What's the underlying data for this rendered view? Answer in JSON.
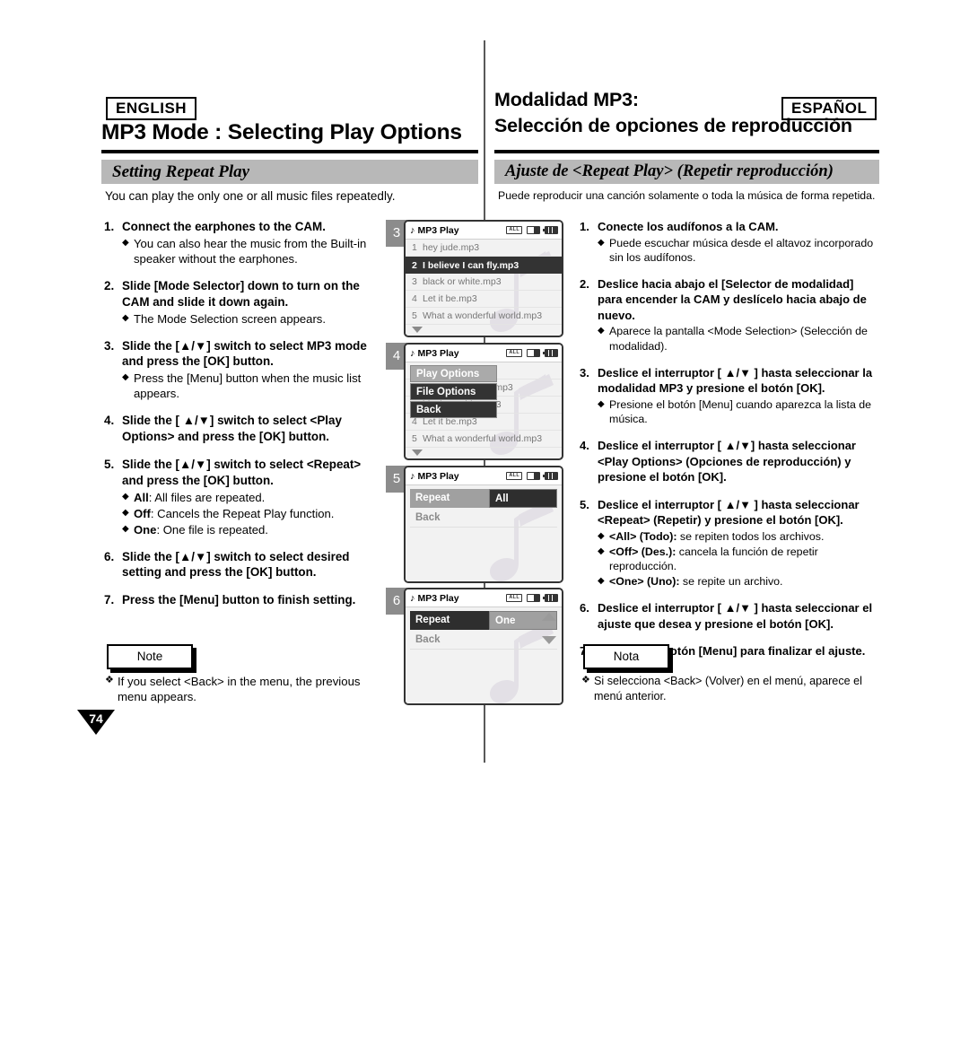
{
  "page": {
    "number": "74"
  },
  "english": {
    "lang_tag": "ENGLISH",
    "title": "MP3 Mode : Selecting Play Options",
    "banner": "Setting Repeat Play",
    "intro": "You can play the only one or all music files repeatedly.",
    "steps": [
      {
        "num": "1.",
        "main": "Connect the earphones to the CAM.",
        "subs": [
          {
            "mark": "◆",
            "text": "You can also hear the music from the Built-in speaker without the earphones."
          }
        ]
      },
      {
        "num": "2.",
        "main": "Slide [Mode Selector] down to turn on the CAM and slide it down again.",
        "subs": [
          {
            "mark": "◆",
            "text": "The Mode Selection screen appears."
          }
        ]
      },
      {
        "num": "3.",
        "main": "Slide the [▲/▼] switch to select MP3 mode and press the [OK] button.",
        "subs": [
          {
            "mark": "◆",
            "text": "Press the [Menu] button when the music list appears."
          }
        ]
      },
      {
        "num": "4.",
        "main": "Slide the [ ▲/▼] switch to select <Play Options> and press the [OK] button.",
        "subs": []
      },
      {
        "num": "5.",
        "main": "Slide the [▲/▼] switch to select <Repeat> and press the [OK] button.",
        "subs": [
          {
            "mark": "◆",
            "bold": "All",
            "text": ": All files are repeated."
          },
          {
            "mark": "◆",
            "bold": "Off",
            "text": ": Cancels the Repeat Play function."
          },
          {
            "mark": "◆",
            "bold": "One",
            "text": ": One file is repeated."
          }
        ]
      },
      {
        "num": "6.",
        "main": "Slide the [▲/▼] switch to select desired setting and press the [OK] button.",
        "subs": []
      },
      {
        "num": "7.",
        "main": "Press the [Menu] button to finish setting.",
        "subs": []
      }
    ],
    "note_label": "Note",
    "note_mark": "❖",
    "note_text": "If you select <Back> in the menu, the previous menu appears."
  },
  "spanish": {
    "lang_tag": "ESPAÑOL",
    "title_line1": "Modalidad MP3:",
    "title_line2": "Selección de opciones de reproducción",
    "banner": "Ajuste de <Repeat Play> (Repetir reproducción)",
    "intro": "Puede reproducir una canción solamente o toda la música de forma repetida.",
    "steps": [
      {
        "num": "1.",
        "main": "Conecte los audífonos a la CAM.",
        "subs": [
          {
            "mark": "◆",
            "text": "Puede escuchar música desde el altavoz incorporado sin los audífonos."
          }
        ]
      },
      {
        "num": "2.",
        "main": "Deslice hacia abajo el [Selector de modalidad] para encender la CAM y deslícelo hacia abajo de nuevo.",
        "subs": [
          {
            "mark": "◆",
            "text": "Aparece la pantalla <Mode Selection> (Selección de modalidad)."
          }
        ]
      },
      {
        "num": "3.",
        "main": "Deslice el interruptor [ ▲/▼ ] hasta seleccionar la modalidad MP3 y presione el botón [OK].",
        "subs": [
          {
            "mark": "◆",
            "text": "Presione el botón [Menu] cuando aparezca la lista de música."
          }
        ]
      },
      {
        "num": "4.",
        "main": "Deslice el interruptor [ ▲/▼] hasta seleccionar <Play Options> (Opciones de reproducción) y presione el botón [OK].",
        "subs": []
      },
      {
        "num": "5.",
        "main": "Deslice el interruptor [ ▲/▼ ] hasta seleccionar <Repeat> (Repetir) y presione el botón [OK].",
        "subs": [
          {
            "mark": "◆",
            "bold": "<All> (Todo):",
            "text": " se repiten todos los archivos."
          },
          {
            "mark": "◆",
            "bold": "<Off> (Des.):",
            "text": " cancela la función de repetir reproducción."
          },
          {
            "mark": "◆",
            "bold": "<One> (Uno):",
            "text": " se repite un archivo."
          }
        ]
      },
      {
        "num": "6.",
        "main": "Deslice el interruptor [ ▲/▼ ] hasta seleccionar el ajuste que desea y presione el botón [OK].",
        "subs": []
      },
      {
        "num": "7.",
        "main": "Presione el botón [Menu] para finalizar el ajuste.",
        "subs": []
      }
    ],
    "note_label": "Nota",
    "note_mark": "❖",
    "note_text": "Si selecciona <Back> (Volver) en el menú, aparece el menú anterior."
  },
  "lcd_screens": [
    {
      "step_number": "3",
      "title": "MP3 Play",
      "icons": [
        "all-repeat-icon",
        "memory-card-icon",
        "battery-icon"
      ],
      "icon_all_label": "ALL",
      "list": [
        {
          "idx": "1",
          "name": "hey jude.mp3",
          "selected": false
        },
        {
          "idx": "2",
          "name": "I believe I can fly.mp3",
          "selected": true
        },
        {
          "idx": "3",
          "name": "black or white.mp3",
          "selected": false
        },
        {
          "idx": "4",
          "name": "Let it be.mp3",
          "selected": false
        },
        {
          "idx": "5",
          "name": "What a wonderful world.mp3",
          "selected": false
        }
      ],
      "scroll_down": true
    },
    {
      "step_number": "4",
      "title": "MP3 Play",
      "icons": [
        "all-repeat-icon",
        "memory-card-icon",
        "battery-icon"
      ],
      "icon_all_label": "ALL",
      "list": [
        {
          "idx": "1",
          "name": "hey jude.mp3",
          "selected": false
        },
        {
          "idx": "2",
          "name": "I believe I can fly.mp3",
          "selected": false
        },
        {
          "idx": "3",
          "name": "black or white.mp3",
          "selected": false
        },
        {
          "idx": "4",
          "name": "Let it be.mp3",
          "selected": false
        },
        {
          "idx": "5",
          "name": "What a wonderful world.mp3",
          "selected": false
        }
      ],
      "popup_menu": [
        {
          "label": "Play Options",
          "style": "gray"
        },
        {
          "label": "File Options",
          "style": "dark"
        },
        {
          "label": "Back",
          "style": "dark"
        }
      ],
      "scroll_down": true
    },
    {
      "step_number": "5",
      "title": "MP3 Play",
      "icons": [
        "all-repeat-icon",
        "memory-card-icon",
        "battery-icon"
      ],
      "icon_all_label": "ALL",
      "setting_label": "Repeat",
      "setting_value": "All",
      "label_style": "gray",
      "value_style": "dark",
      "back_label": "Back",
      "arrows": false
    },
    {
      "step_number": "6",
      "title": "MP3 Play",
      "icons": [
        "all-repeat-icon",
        "memory-card-icon",
        "battery-icon"
      ],
      "icon_all_label": "ALL",
      "setting_label": "Repeat",
      "setting_value": "One",
      "label_style": "dark",
      "value_style": "gray",
      "back_label": "Back",
      "arrows": true
    }
  ]
}
